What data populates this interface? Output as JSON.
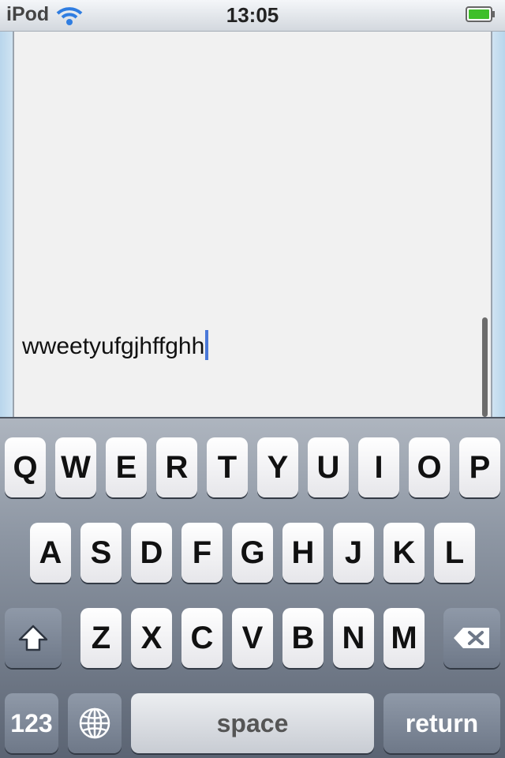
{
  "status_bar": {
    "carrier": "iPod",
    "time": "13:05",
    "wifi_icon": "wifi-icon",
    "battery_icon": "battery-icon",
    "battery_color": "#3fbf2a"
  },
  "text_view": {
    "text": "wweetyufgjhffghh",
    "caret_color": "#4a78d8"
  },
  "keyboard": {
    "row1": [
      "Q",
      "W",
      "E",
      "R",
      "T",
      "Y",
      "U",
      "I",
      "O",
      "P"
    ],
    "row2": [
      "A",
      "S",
      "D",
      "F",
      "G",
      "H",
      "J",
      "K",
      "L"
    ],
    "row3": [
      "Z",
      "X",
      "C",
      "V",
      "B",
      "N",
      "M"
    ],
    "shift_icon": "shift-icon",
    "delete_icon": "delete-icon",
    "numbers_label": "123",
    "globe_icon": "globe-icon",
    "space_label": "space",
    "return_label": "return"
  }
}
